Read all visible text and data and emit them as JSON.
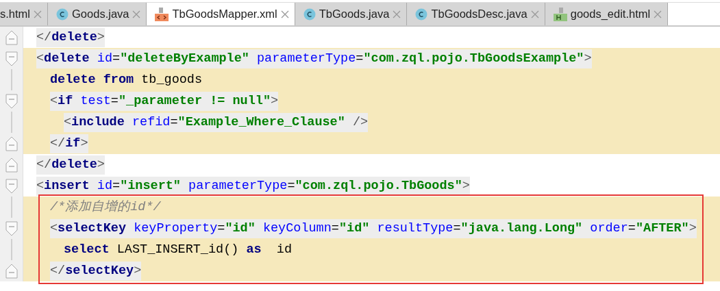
{
  "tabs": [
    {
      "label": "s.html",
      "kind": "plain",
      "selected": false
    },
    {
      "label": "Goods.java",
      "kind": "class",
      "selected": false
    },
    {
      "label": "TbGoodsMapper.xml",
      "kind": "xml",
      "selected": true
    },
    {
      "label": "TbGoods.java",
      "kind": "class",
      "selected": false
    },
    {
      "label": "TbGoodsDesc.java",
      "kind": "class",
      "selected": false
    },
    {
      "label": "goods_edit.html",
      "kind": "html",
      "selected": false
    }
  ],
  "editor": {
    "lines": [
      {
        "kind": "fold-end",
        "highlighted": false,
        "tag_shaded": true,
        "tokens": [
          {
            "kind": "bracket",
            "text": "</"
          },
          {
            "kind": "tag",
            "text": "delete"
          },
          {
            "kind": "bracket",
            "text": ">"
          }
        ]
      },
      {
        "kind": "fold-start",
        "highlighted": true,
        "tag_shaded": true,
        "tokens": [
          {
            "kind": "bracket",
            "text": "<"
          },
          {
            "kind": "tag",
            "text": "delete "
          },
          {
            "kind": "attr",
            "text": "id"
          },
          {
            "kind": "punct",
            "text": "="
          },
          {
            "kind": "value",
            "text": "\"deleteByExample\" "
          },
          {
            "kind": "attr",
            "text": "parameterType"
          },
          {
            "kind": "punct",
            "text": "="
          },
          {
            "kind": "value",
            "text": "\"com.zql.pojo.TbGoodsExample\""
          },
          {
            "kind": "bracket",
            "text": ">"
          }
        ],
        "children": [
          {
            "kind": "plain",
            "highlighted": true,
            "tag_shaded": false,
            "tokens": [
              {
                "kind": "keyword",
                "text": "delete from "
              },
              {
                "kind": "plain",
                "text": "tb_goods"
              }
            ]
          },
          {
            "kind": "fold-start",
            "highlighted": true,
            "tag_shaded": true,
            "tokens": [
              {
                "kind": "bracket",
                "text": "<"
              },
              {
                "kind": "tag",
                "text": "if "
              },
              {
                "kind": "attr",
                "text": "test"
              },
              {
                "kind": "punct",
                "text": "="
              },
              {
                "kind": "value",
                "text": "\"_parameter != null\""
              },
              {
                "kind": "bracket",
                "text": ">"
              }
            ],
            "children": [
              {
                "kind": "plain",
                "highlighted": true,
                "tag_shaded": true,
                "tokens": [
                  {
                    "kind": "bracket",
                    "text": "<"
                  },
                  {
                    "kind": "tag",
                    "text": "include "
                  },
                  {
                    "kind": "attr",
                    "text": "refid"
                  },
                  {
                    "kind": "punct",
                    "text": "="
                  },
                  {
                    "kind": "value",
                    "text": "\"Example_Where_Clause\" "
                  },
                  {
                    "kind": "bracket",
                    "text": "/>"
                  }
                ]
              }
            ]
          },
          {
            "kind": "fold-end",
            "highlighted": true,
            "tag_shaded": true,
            "tokens": [
              {
                "kind": "bracket",
                "text": "</"
              },
              {
                "kind": "tag",
                "text": "if"
              },
              {
                "kind": "bracket",
                "text": ">"
              }
            ]
          }
        ]
      },
      {
        "kind": "fold-end",
        "highlighted": false,
        "tag_shaded": true,
        "tokens": [
          {
            "kind": "bracket",
            "text": "</"
          },
          {
            "kind": "tag",
            "text": "delete"
          },
          {
            "kind": "bracket",
            "text": ">"
          }
        ]
      },
      {
        "kind": "fold-start",
        "highlighted": false,
        "tag_shaded": true,
        "boxed_children": true,
        "tokens": [
          {
            "kind": "bracket",
            "text": "<"
          },
          {
            "kind": "tag",
            "text": "insert "
          },
          {
            "kind": "attr",
            "text": "id"
          },
          {
            "kind": "punct",
            "text": "="
          },
          {
            "kind": "value",
            "text": "\"insert\" "
          },
          {
            "kind": "attr",
            "text": "parameterType"
          },
          {
            "kind": "punct",
            "text": "="
          },
          {
            "kind": "value",
            "text": "\"com.zql.pojo.TbGoods\""
          },
          {
            "kind": "bracket",
            "text": ">"
          }
        ],
        "children": [
          {
            "kind": "plain",
            "highlighted": true,
            "tag_shaded": false,
            "tokens": [
              {
                "kind": "comment",
                "text": "/*添加自增的id*/"
              }
            ]
          },
          {
            "kind": "fold-start",
            "highlighted": true,
            "tag_shaded": true,
            "tokens": [
              {
                "kind": "bracket",
                "text": "<"
              },
              {
                "kind": "tag",
                "text": "selectKey "
              },
              {
                "kind": "attr",
                "text": "keyProperty"
              },
              {
                "kind": "punct",
                "text": "="
              },
              {
                "kind": "value",
                "text": "\"id\" "
              },
              {
                "kind": "attr",
                "text": "keyColumn"
              },
              {
                "kind": "punct",
                "text": "="
              },
              {
                "kind": "value",
                "text": "\"id\" "
              },
              {
                "kind": "attr",
                "text": "resultType"
              },
              {
                "kind": "punct",
                "text": "="
              },
              {
                "kind": "value",
                "text": "\"java.lang.Long\" "
              },
              {
                "kind": "attr",
                "text": "order"
              },
              {
                "kind": "punct",
                "text": "="
              },
              {
                "kind": "value",
                "text": "\"AFTER\""
              },
              {
                "kind": "bracket",
                "text": ">"
              }
            ],
            "children": [
              {
                "kind": "plain",
                "highlighted": true,
                "tag_shaded": false,
                "tokens": [
                  {
                    "kind": "keyword",
                    "text": "select "
                  },
                  {
                    "kind": "plain",
                    "text": "LAST_INSERT_id() "
                  },
                  {
                    "kind": "keyword",
                    "text": "as "
                  },
                  {
                    "kind": "plain",
                    "text": " id"
                  }
                ]
              }
            ]
          },
          {
            "kind": "fold-end",
            "highlighted": true,
            "tag_shaded": true,
            "tokens": [
              {
                "kind": "bracket",
                "text": "</"
              },
              {
                "kind": "tag",
                "text": "selectKey"
              },
              {
                "kind": "bracket",
                "text": ">"
              }
            ]
          }
        ]
      }
    ]
  }
}
